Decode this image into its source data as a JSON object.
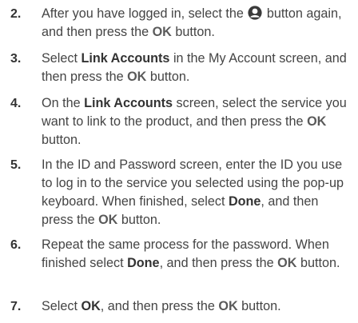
{
  "steps": [
    {
      "num": "2.",
      "parts": [
        "After you have logged in, select the",
        "button again, and then press the",
        "OK",
        "button."
      ],
      "icon": "smart-hub-profile-icon"
    },
    {
      "num": "3.",
      "parts": [
        "Select",
        "Link Accounts",
        "in the My Account screen, and then press the",
        "OK",
        "button."
      ]
    },
    {
      "num": "4.",
      "parts": [
        "On the",
        "Link Accounts",
        "screen, select the service you want to link to the product, and then press the",
        "OK",
        "button."
      ]
    },
    {
      "num": "5.",
      "parts": [
        "In the ID and Password screen, enter the ID you use to log in to the service you selected using the pop-up keyboard. When finished, select",
        "Done",
        ", and then press the",
        "OK",
        "button."
      ]
    },
    {
      "num": "6.",
      "parts": [
        "Repeat the same process for the password. When finished select",
        "Done",
        ", and then press the",
        "OK",
        "button."
      ]
    },
    {
      "num": "7.",
      "parts": [
        "Select",
        "OK",
        ", and then press the",
        "OK",
        "button."
      ]
    }
  ]
}
